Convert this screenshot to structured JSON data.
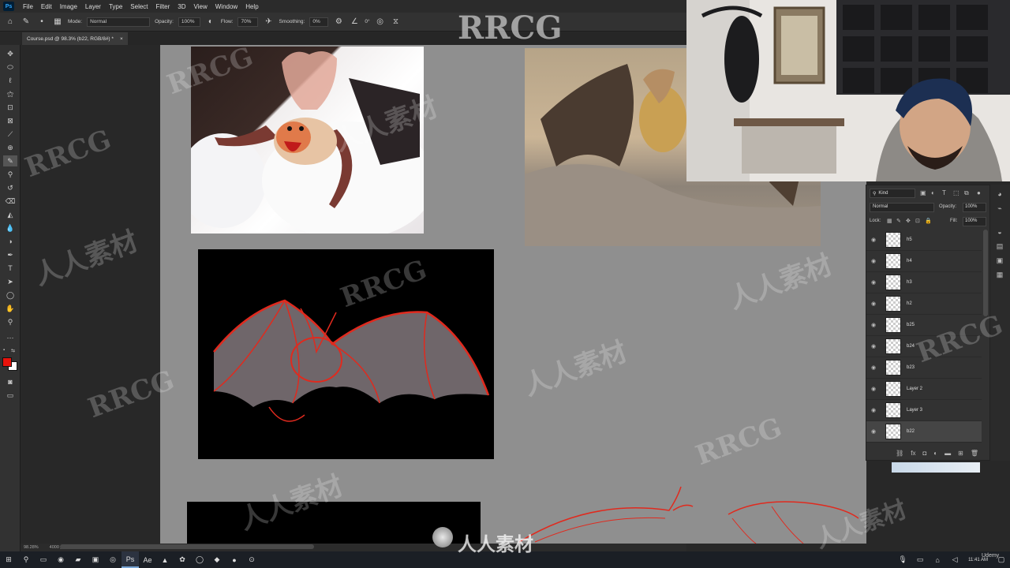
{
  "app": {
    "logo": "Ps",
    "menu": [
      "File",
      "Edit",
      "Image",
      "Layer",
      "Type",
      "Select",
      "Filter",
      "3D",
      "View",
      "Window",
      "Help"
    ]
  },
  "options": {
    "mode_label": "Mode:",
    "mode_value": "Normal",
    "opacity_label": "Opacity:",
    "opacity_value": "100%",
    "flow_label": "Flow:",
    "flow_value": "70%",
    "smoothing_label": "Smoothing:",
    "smoothing_value": "0%",
    "angle_value": "0°"
  },
  "document": {
    "tab_title": "Course.psd @ 98.3% (b22, RGB/8#) *",
    "close_glyph": "×"
  },
  "status": {
    "zoom": "98.28%",
    "doc_info": "4000 px x 4000 px (300 ppi)"
  },
  "layers_panel": {
    "filter_kind": "Kind",
    "blend_mode": "Normal",
    "opacity_label": "Opacity:",
    "opacity_value": "100%",
    "lock_label": "Lock:",
    "fill_label": "Fill:",
    "fill_value": "100%",
    "layers": [
      {
        "name": "h5",
        "selected": false
      },
      {
        "name": "h4",
        "selected": false
      },
      {
        "name": "h3",
        "selected": false
      },
      {
        "name": "h2",
        "selected": false
      },
      {
        "name": "b25",
        "selected": false
      },
      {
        "name": "b24",
        "selected": false
      },
      {
        "name": "b23",
        "selected": false
      },
      {
        "name": "Layer 2",
        "selected": false
      },
      {
        "name": "Layer 3",
        "selected": false
      },
      {
        "name": "b22",
        "selected": true
      }
    ]
  },
  "taskbar": {
    "time": "11:41 AM"
  },
  "watermarks": {
    "brand": "RRCG",
    "cn": "人人素材",
    "bottom": "人人素材",
    "udemy": "Udemy"
  },
  "colors": {
    "foreground": "#e8130c",
    "background": "#ffffff",
    "accent": "#31a8ff",
    "sketch_red": "#e02a1e"
  }
}
